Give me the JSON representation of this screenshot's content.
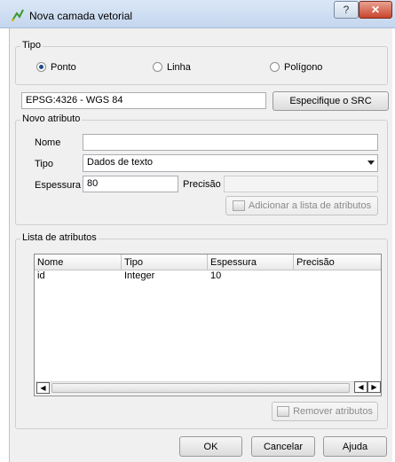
{
  "window": {
    "title": "Nova camada vetorial",
    "help_label": "?",
    "close_label": "✕"
  },
  "tipo": {
    "title": "Tipo",
    "options": [
      {
        "label": "Ponto",
        "selected": true
      },
      {
        "label": "Linha",
        "selected": false
      },
      {
        "label": "Polígono",
        "selected": false
      }
    ]
  },
  "crs": {
    "value": "EPSG:4326 - WGS 84",
    "button_label": "Especifique o SRC"
  },
  "novo_atributo": {
    "title": "Novo atributo",
    "nome_label": "Nome",
    "nome_value": "",
    "tipo_label": "Tipo",
    "tipo_value": "Dados de texto",
    "espessura_label": "Espessura",
    "espessura_value": "80",
    "precisao_label": "Precisão",
    "precisao_value": "",
    "add_button_label": "Adicionar a lista de atributos"
  },
  "lista": {
    "title": "Lista de atributos",
    "columns": [
      "Nome",
      "Tipo",
      "Espessura",
      "Precisão"
    ],
    "rows": [
      [
        "id",
        "Integer",
        "10",
        ""
      ]
    ],
    "remove_button_label": "Remover atributos"
  },
  "footer": {
    "ok_label": "OK",
    "cancel_label": "Cancelar",
    "help_label": "Ajuda"
  },
  "colors": {
    "titlebar": "#c4d6ee",
    "close_button": "#c9442d",
    "dialog_background": "#f0f0f0"
  }
}
